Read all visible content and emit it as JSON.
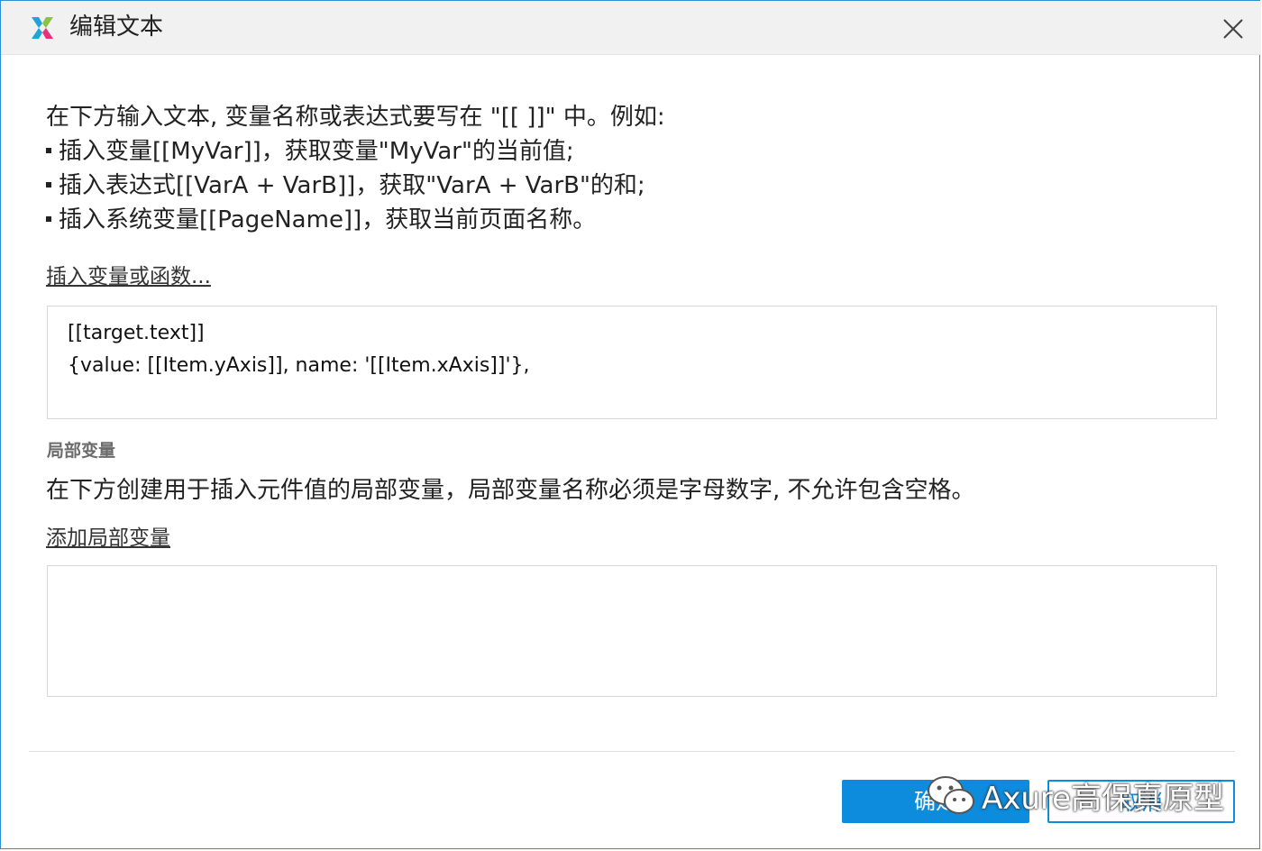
{
  "window": {
    "title": "编辑文本",
    "close_icon": "close-icon",
    "logo_icon": "axure-logo-icon"
  },
  "instructions": {
    "line1": "在下方输入文本, 变量名称或表达式要写在 \"[[ ]]\" 中。例如:",
    "bullet1": "插入变量[[MyVar]]，获取变量\"MyVar\"的当前值;",
    "bullet2": "插入表达式[[VarA + VarB]]，获取\"VarA + VarB\"的和;",
    "bullet3": "插入系统变量[[PageName]]，获取当前页面名称。"
  },
  "insert_link": "插入变量或函数...",
  "editor": {
    "lines": [
      "[[target.text]]",
      "{value: [[Item.yAxis]], name: '[[Item.xAxis]]'},"
    ]
  },
  "local_vars": {
    "label": "局部变量",
    "description": "在下方创建用于插入元件值的局部变量，局部变量名称必须是字母数字, 不允许包含空格。",
    "add_link": "添加局部变量"
  },
  "buttons": {
    "ok": "确定",
    "cancel": "取消"
  },
  "watermark": {
    "text": "Axure高保真原型",
    "icon": "wechat-icon"
  },
  "colors": {
    "accent": "#0d8bdc",
    "border": "#2b8fd6"
  }
}
